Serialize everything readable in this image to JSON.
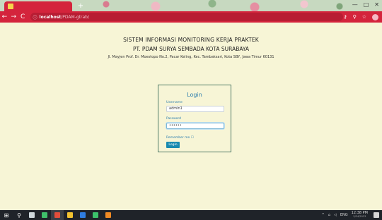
{
  "browser": {
    "new_tab_symbol": "+",
    "window_controls": [
      "—",
      "□",
      "✕"
    ],
    "nav": {
      "back": "←",
      "forward": "→",
      "reload": "C"
    },
    "omnibox": {
      "info_symbol": "ⓘ",
      "host": "localhost",
      "path": "/PDAM-gtrab/"
    },
    "toolbar_icons": {
      "key": "⚷",
      "zoom": "⚲",
      "star": "☆"
    }
  },
  "page": {
    "header": {
      "line1": "SISTEM INFORMASI MONITORING KERJA PRAKTEK",
      "line2": "PT. PDAM SURYA SEMBADA KOTA SURABAYA",
      "address": "Jl. Mayjen Prof. Dr. Moestopo No.2, Pacar Keling, Kec. Tambaksari, Kota SBY, Jawa Timur 60131"
    },
    "login": {
      "title": "Login",
      "username_label": "Username",
      "username_value": "admin1",
      "password_label": "Password",
      "password_value": "••••••",
      "remember_label": "Remember me ☐",
      "button_label": "Login"
    }
  },
  "taskbar": {
    "start_symbol": "⊞",
    "search_symbol": "⚲",
    "apps": [
      {
        "name": "task-view",
        "color": "#cfd8dc"
      },
      {
        "name": "app-green",
        "color": "#3fbf6a"
      },
      {
        "name": "app-chrome",
        "color": "#e24d3b",
        "active": true
      },
      {
        "name": "app-files",
        "color": "#f2c230"
      },
      {
        "name": "app-blue",
        "color": "#2f7de1"
      },
      {
        "name": "app-whatsapp",
        "color": "#3cc16b"
      },
      {
        "name": "app-orange",
        "color": "#f08a24"
      }
    ],
    "tray": {
      "up_arrow": "^",
      "network": "⌂",
      "volume": "◁",
      "language": "ENG",
      "time": "12:38 PM",
      "date": "5/24/2023"
    }
  },
  "colors": {
    "chrome_red": "#d4243c",
    "page_bg": "#f7f5d6",
    "accent_blue": "#2b7dad",
    "button_blue": "#1a8bb0",
    "card_border": "#4f7a66"
  }
}
